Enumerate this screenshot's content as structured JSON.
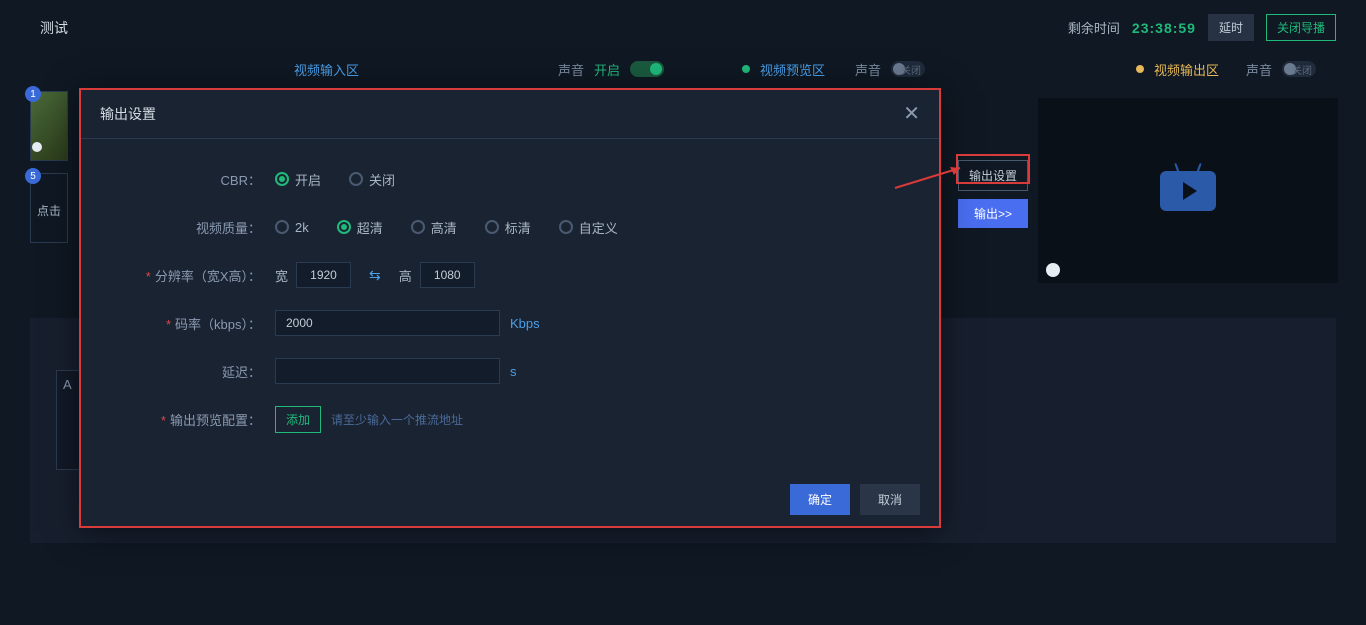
{
  "topbar": {
    "title": "测试",
    "remaining_label": "剩余时间",
    "remaining_time": "23:38:59",
    "extend_btn": "延时",
    "close_btn": "关闭导播"
  },
  "tabs": {
    "input_area": "视频输入区",
    "audio_label": "声音",
    "on_label": "开启",
    "preview_area": "视频预览区",
    "off_label": "关闭",
    "output_area": "视频输出区"
  },
  "thumbs": {
    "badge1": "1",
    "badge5": "5",
    "click_hint": "点击"
  },
  "side_buttons": {
    "output_settings": "输出设置",
    "output_action": "输出>>"
  },
  "inner_box": {
    "text": "A"
  },
  "modal": {
    "title": "输出设置",
    "labels": {
      "cbr": "CBR：",
      "video_quality": "视频质量：",
      "resolution": "分辨率（宽X高）：",
      "bitrate": "码率（kbps）：",
      "delay": "延迟：",
      "preview_config": "输出预览配置："
    },
    "cbr": {
      "on": "开启",
      "off": "关闭"
    },
    "quality": {
      "k2": "2k",
      "uhd": "超清",
      "hd": "高清",
      "sd": "标清",
      "custom": "自定义"
    },
    "resolution": {
      "width_label": "宽",
      "width": "1920",
      "height_label": "高",
      "height": "1080"
    },
    "bitrate": {
      "value": "2000",
      "unit": "Kbps"
    },
    "delay": {
      "value": "",
      "unit": "s"
    },
    "preview": {
      "add_btn": "添加",
      "hint": "请至少输入一个推流地址"
    },
    "footer": {
      "ok": "确定",
      "cancel": "取消"
    }
  }
}
